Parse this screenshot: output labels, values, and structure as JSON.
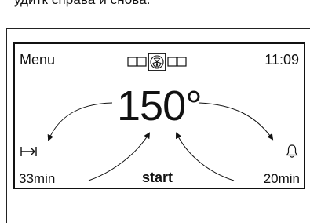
{
  "caption": {
    "text": "удитк справа и снова."
  },
  "display": {
    "menu_label": "Menu",
    "clock": "11:09",
    "temperature": "150°",
    "start_label": "start",
    "cook_time": "33min",
    "alarm_time": "20min",
    "mode_icons": [
      "square",
      "square",
      "fan",
      "square",
      "square"
    ],
    "icons": {
      "left": "end-time-icon",
      "right": "bell-icon"
    }
  }
}
